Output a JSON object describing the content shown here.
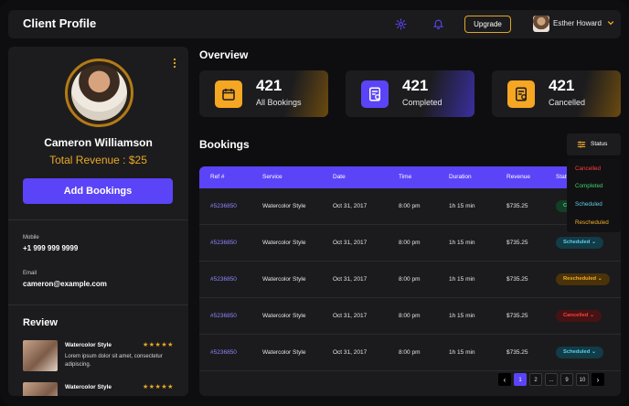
{
  "header": {
    "title": "Client Profile",
    "upgrade_label": "Upgrade",
    "user_name": "Esther Howard",
    "icons": [
      "gear-icon",
      "bell-icon",
      "chevron-down-icon"
    ]
  },
  "profile": {
    "name": "Cameron Williamson",
    "revenue": "Total Revenue  : $25",
    "add_button": "Add Bookings",
    "mobile_label": "Mobile",
    "mobile_value": "+1 999 999 9999",
    "email_label": "Email",
    "email_value": "cameron@example.com"
  },
  "review": {
    "title": "Review",
    "items": [
      {
        "name": "Watercolor Style",
        "stars": "★★★★★",
        "text": "Lorem ipsum dolor sit amet, consectetur adipiscing."
      },
      {
        "name": "Watercolor Style",
        "stars": "★★★★★",
        "text": ""
      }
    ]
  },
  "overview": {
    "title": "Overview",
    "cards": [
      {
        "value": "421",
        "label": "All Bookings",
        "icon": "calendar-icon",
        "color": "#f5a623"
      },
      {
        "value": "421",
        "label": "Completed",
        "icon": "document-check-icon",
        "color": "#5b44f7"
      },
      {
        "value": "421",
        "label": "Cancelled",
        "icon": "document-cancel-icon",
        "color": "#f5a623"
      }
    ]
  },
  "bookings": {
    "title": "Bookings",
    "status_button": "Status",
    "columns": [
      "Ref #",
      "Service",
      "Date",
      "Time",
      "Duration",
      "Revenue",
      "Status"
    ],
    "rows": [
      {
        "ref": "#5236850",
        "service": "Watercolor Style",
        "date": "Oct 31, 2017",
        "time": "8:00 pm",
        "duration": "1h 15 min",
        "revenue": "$735.25",
        "status": "Completed",
        "kind": "done"
      },
      {
        "ref": "#5236850",
        "service": "Watercolor Style",
        "date": "Oct 31, 2017",
        "time": "8:00 pm",
        "duration": "1h 15 min",
        "revenue": "$735.25",
        "status": "Scheduled",
        "kind": "sched"
      },
      {
        "ref": "#5236850",
        "service": "Watercolor Style",
        "date": "Oct 31, 2017",
        "time": "8:00 pm",
        "duration": "1h 15 min",
        "revenue": "$735.25",
        "status": "Rescheduled",
        "kind": "resch"
      },
      {
        "ref": "#5236850",
        "service": "Watercolor Style",
        "date": "Oct 31, 2017",
        "time": "8:00 pm",
        "duration": "1h 15 min",
        "revenue": "$735.25",
        "status": "Cancelled",
        "kind": "cancel"
      },
      {
        "ref": "#5236850",
        "service": "Watercolor Style",
        "date": "Oct 31, 2017",
        "time": "8:00 pm",
        "duration": "1h 15 min",
        "revenue": "$735.25",
        "status": "Scheduled",
        "kind": "sched"
      }
    ],
    "status_options": [
      {
        "label": "Cancelled",
        "color": "#ff3b3b"
      },
      {
        "label": "Completed",
        "color": "#3fcf6e"
      },
      {
        "label": "Scheduled",
        "color": "#5fd0e8"
      },
      {
        "label": "Rescheduled",
        "color": "#f1ad2a"
      }
    ],
    "pagination": [
      "1",
      "2",
      "...",
      "9",
      "10"
    ],
    "current_page": "1"
  }
}
